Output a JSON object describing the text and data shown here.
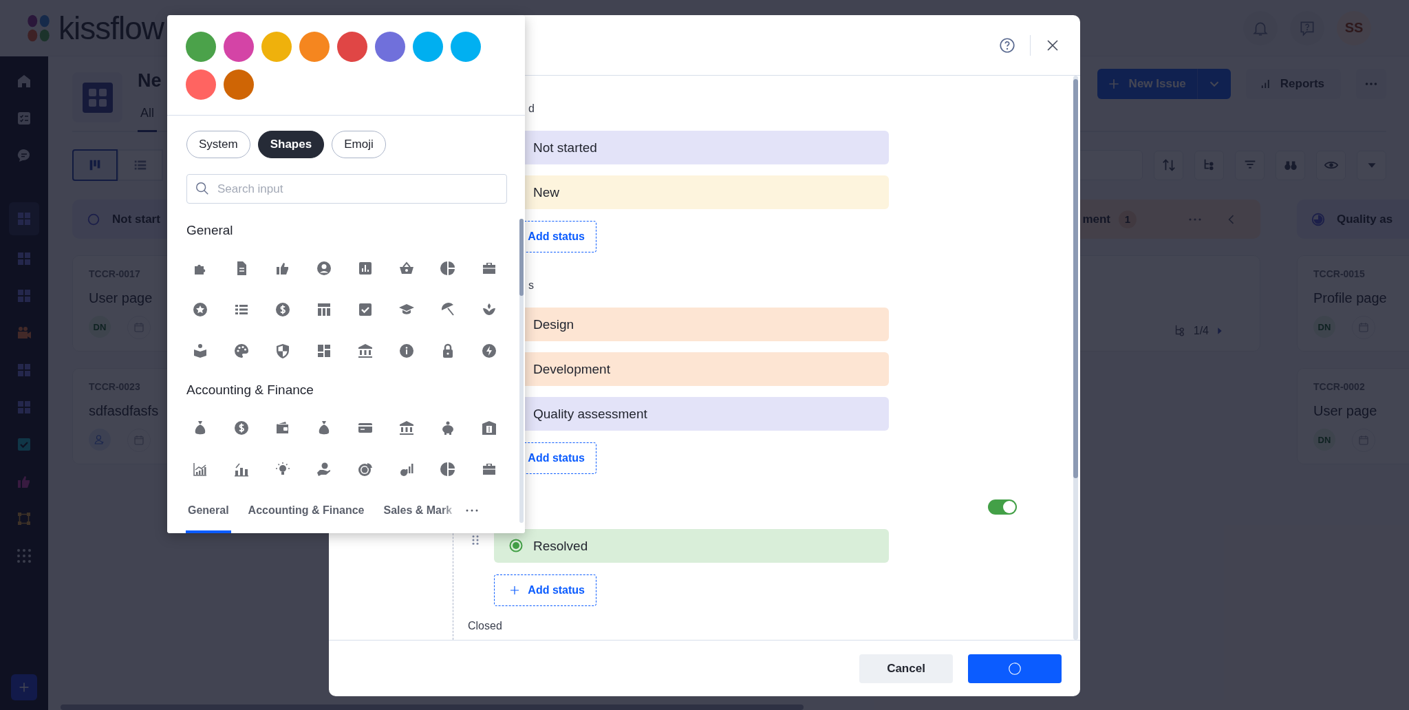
{
  "app": {
    "logo": "kissflow",
    "avatar": "SS"
  },
  "sidebar": {
    "items": [
      {
        "kind": "home",
        "selected": false
      },
      {
        "kind": "checklist",
        "selected": false
      },
      {
        "kind": "chat",
        "selected": false
      },
      {
        "kind": "grid",
        "selected": true
      },
      {
        "kind": "grid",
        "selected": false
      },
      {
        "kind": "grid",
        "selected": false
      },
      {
        "kind": "camera",
        "selected": false
      },
      {
        "kind": "grid",
        "selected": false
      },
      {
        "kind": "grid",
        "selected": false
      },
      {
        "kind": "check",
        "selected": false
      },
      {
        "kind": "thumb",
        "selected": false
      },
      {
        "kind": "flow",
        "selected": false
      },
      {
        "kind": "apps",
        "selected": false
      }
    ]
  },
  "board": {
    "title": "Ne",
    "tabs": [
      {
        "label": "All",
        "selected": true
      }
    ],
    "actions": {
      "new_issue": "New Issue",
      "reports": "Reports"
    },
    "view_toggle": [
      {
        "kind": "board",
        "selected": true
      },
      {
        "kind": "list",
        "selected": false
      }
    ],
    "columns": [
      {
        "title": "Not start",
        "kind": "todo",
        "cards": [
          {
            "id": "TCCR-0017",
            "title": "User page",
            "assignee": "DN"
          },
          {
            "id": "TCCR-0023",
            "title": "sdfasdfasfs"
          }
        ]
      },
      {
        "title": "ment",
        "count": "1",
        "kind": "progress",
        "cards": [
          {
            "subtasks": "1/4"
          }
        ]
      },
      {
        "title": "Quality as",
        "kind": "review",
        "cards": [
          {
            "id": "TCCR-0015",
            "title": "Profile page",
            "assignee": "DN"
          },
          {
            "id": "TCCR-0002",
            "title": "User page",
            "assignee": "DN"
          }
        ]
      }
    ]
  },
  "modal": {
    "groups": [
      {
        "label": "d",
        "statuses": [
          {
            "name": "Not started",
            "color": "#e3e3f8"
          },
          {
            "name": "New",
            "color": "#fdf4dd"
          }
        ],
        "add_button": {
          "label": "Add status"
        }
      },
      {
        "label": "s",
        "statuses": [
          {
            "name": "Design",
            "color": "#fde5d3"
          },
          {
            "name": "Development",
            "color": "#fde5d3"
          },
          {
            "name": "Quality assessment",
            "color": "#e3e3f8"
          }
        ],
        "add_button": {
          "label": "Add status"
        }
      },
      {
        "toggle": {
          "on": true
        },
        "statuses": [
          {
            "name": "Resolved",
            "color": "#d9eed9",
            "dot": {
              "color": "#43a047"
            }
          }
        ],
        "add_button": {
          "label": "Add status"
        }
      }
    ],
    "closed_label": "Closed",
    "cancel": "Cancel",
    "saving": true
  },
  "picker": {
    "colors": [
      {
        "color": "#4ba24a"
      },
      {
        "color": "#d444a6"
      },
      {
        "color": "#efb10c"
      },
      {
        "color": "#f5861f"
      },
      {
        "color": "#e04645"
      },
      {
        "color": "#7070db"
      },
      {
        "color": "#00aff0"
      },
      {
        "color": "#01b0f1"
      },
      {
        "color": "#ff6461"
      },
      {
        "color": "#cf6505"
      }
    ],
    "icon_sets": [
      {
        "label": "System",
        "selected": false
      },
      {
        "label": "Shapes",
        "selected": true
      },
      {
        "label": "Emoji",
        "selected": false
      }
    ],
    "search": {
      "placeholder": "Search input"
    },
    "sections": [
      {
        "title": "General"
      },
      {
        "title": "Accounting & Finance"
      }
    ],
    "category_tabs": [
      {
        "label": "General",
        "selected": true
      },
      {
        "label": "Accounting & Finance",
        "selected": false
      },
      {
        "label": "Sales & Mark",
        "selected": false
      }
    ]
  }
}
